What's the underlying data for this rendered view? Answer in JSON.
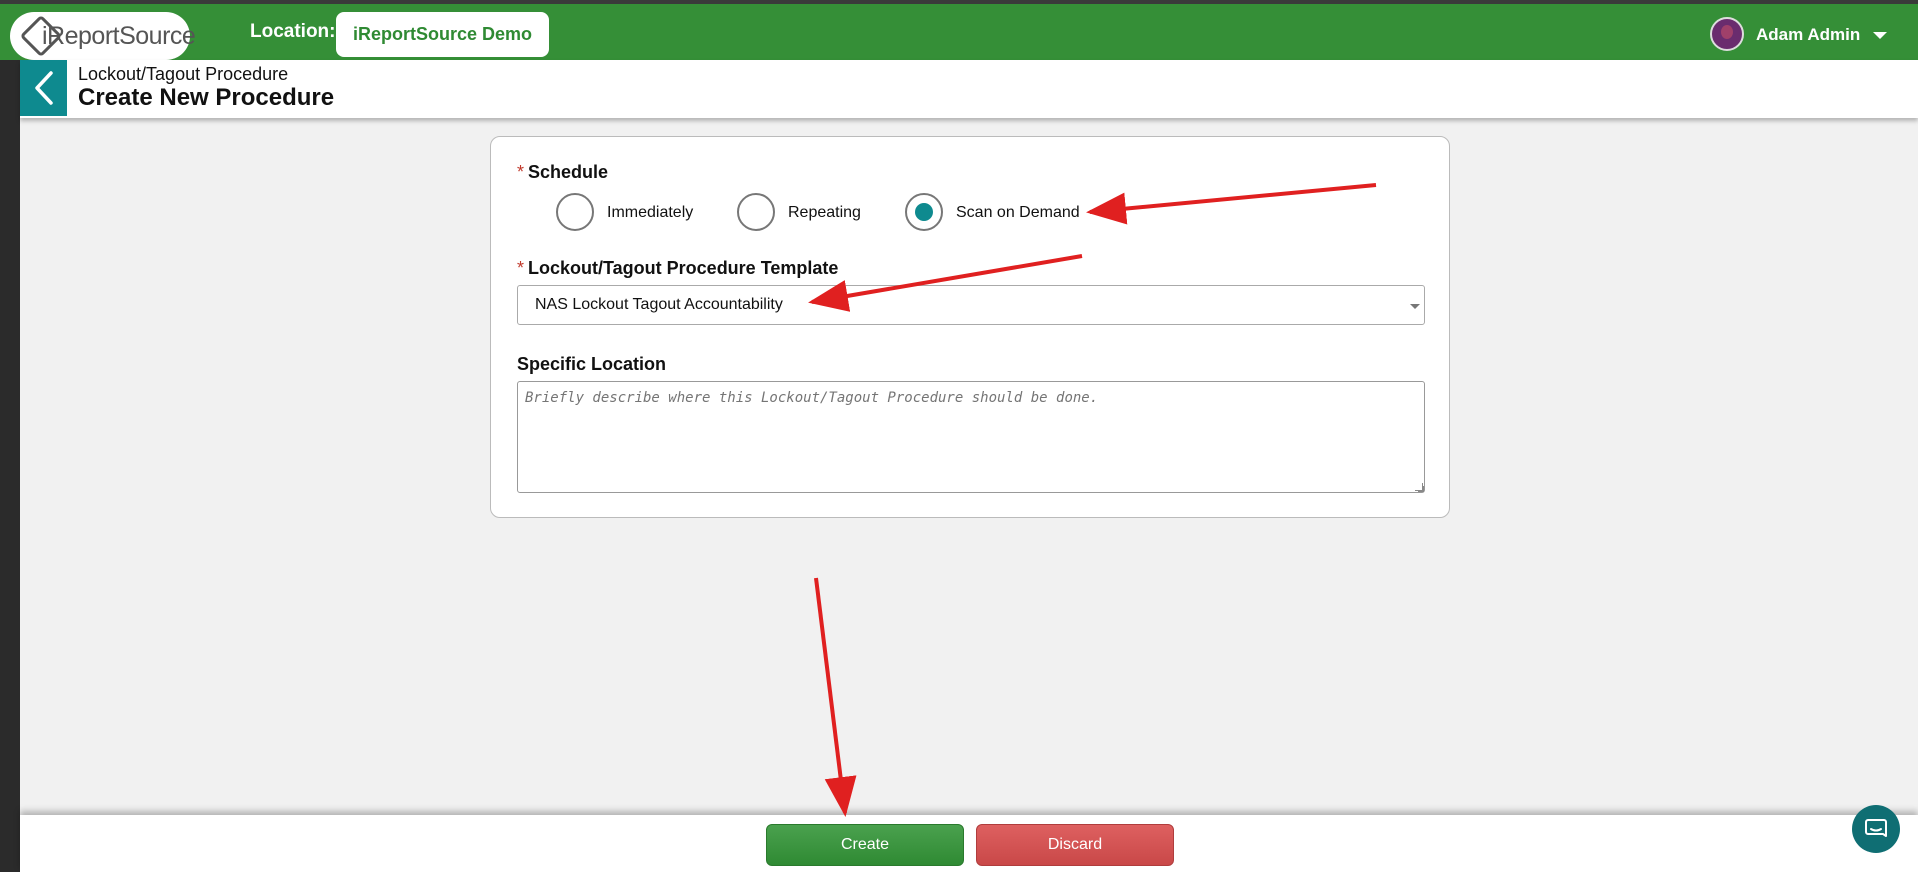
{
  "app": {
    "logo_text": "iReportSource",
    "location_label": "Location:",
    "location_value": "iReportSource Demo",
    "user_name": "Adam Admin"
  },
  "header": {
    "breadcrumb": "Lockout/Tagout Procedure",
    "title": "Create New Procedure"
  },
  "form": {
    "schedule": {
      "label": "Schedule",
      "required_mark": "*",
      "options": [
        "Immediately",
        "Repeating",
        "Scan on Demand"
      ],
      "selected": "Scan on Demand"
    },
    "template": {
      "label": "Lockout/Tagout Procedure Template",
      "required_mark": "*",
      "value": "NAS Lockout Tagout Accountability"
    },
    "location": {
      "label": "Specific Location",
      "placeholder": "Briefly describe where this Lockout/Tagout Procedure should be done.",
      "value": ""
    }
  },
  "footer": {
    "create_label": "Create",
    "discard_label": "Discard"
  },
  "colors": {
    "brand_green": "#358f37",
    "teal": "#0e8a8f",
    "danger": "#c94848",
    "annotation_red": "#e02020"
  },
  "icons": [
    "chevron-left-icon",
    "chevron-down-icon",
    "chat-icon",
    "resize-grip-icon"
  ]
}
